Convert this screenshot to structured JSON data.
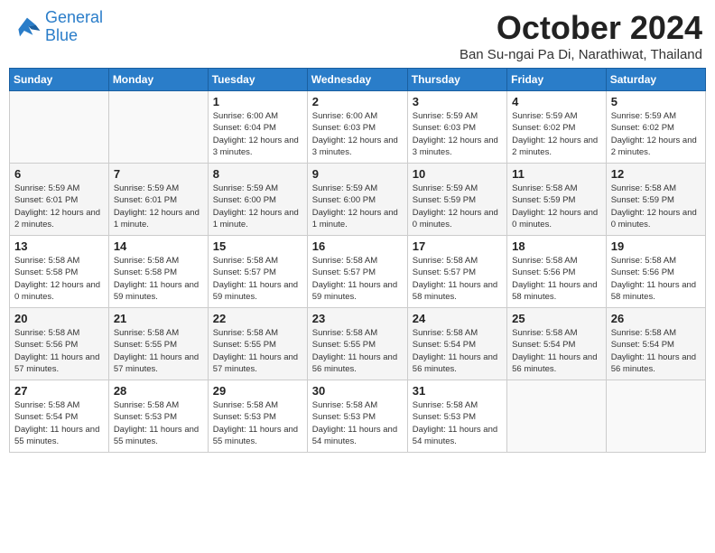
{
  "header": {
    "logo_line1": "General",
    "logo_line2": "Blue",
    "month": "October 2024",
    "location": "Ban Su-ngai Pa Di, Narathiwat, Thailand"
  },
  "weekdays": [
    "Sunday",
    "Monday",
    "Tuesday",
    "Wednesday",
    "Thursday",
    "Friday",
    "Saturday"
  ],
  "weeks": [
    [
      {
        "day": "",
        "info": ""
      },
      {
        "day": "",
        "info": ""
      },
      {
        "day": "1",
        "info": "Sunrise: 6:00 AM\nSunset: 6:04 PM\nDaylight: 12 hours and 3 minutes."
      },
      {
        "day": "2",
        "info": "Sunrise: 6:00 AM\nSunset: 6:03 PM\nDaylight: 12 hours and 3 minutes."
      },
      {
        "day": "3",
        "info": "Sunrise: 5:59 AM\nSunset: 6:03 PM\nDaylight: 12 hours and 3 minutes."
      },
      {
        "day": "4",
        "info": "Sunrise: 5:59 AM\nSunset: 6:02 PM\nDaylight: 12 hours and 2 minutes."
      },
      {
        "day": "5",
        "info": "Sunrise: 5:59 AM\nSunset: 6:02 PM\nDaylight: 12 hours and 2 minutes."
      }
    ],
    [
      {
        "day": "6",
        "info": "Sunrise: 5:59 AM\nSunset: 6:01 PM\nDaylight: 12 hours and 2 minutes."
      },
      {
        "day": "7",
        "info": "Sunrise: 5:59 AM\nSunset: 6:01 PM\nDaylight: 12 hours and 1 minute."
      },
      {
        "day": "8",
        "info": "Sunrise: 5:59 AM\nSunset: 6:00 PM\nDaylight: 12 hours and 1 minute."
      },
      {
        "day": "9",
        "info": "Sunrise: 5:59 AM\nSunset: 6:00 PM\nDaylight: 12 hours and 1 minute."
      },
      {
        "day": "10",
        "info": "Sunrise: 5:59 AM\nSunset: 5:59 PM\nDaylight: 12 hours and 0 minutes."
      },
      {
        "day": "11",
        "info": "Sunrise: 5:58 AM\nSunset: 5:59 PM\nDaylight: 12 hours and 0 minutes."
      },
      {
        "day": "12",
        "info": "Sunrise: 5:58 AM\nSunset: 5:59 PM\nDaylight: 12 hours and 0 minutes."
      }
    ],
    [
      {
        "day": "13",
        "info": "Sunrise: 5:58 AM\nSunset: 5:58 PM\nDaylight: 12 hours and 0 minutes."
      },
      {
        "day": "14",
        "info": "Sunrise: 5:58 AM\nSunset: 5:58 PM\nDaylight: 11 hours and 59 minutes."
      },
      {
        "day": "15",
        "info": "Sunrise: 5:58 AM\nSunset: 5:57 PM\nDaylight: 11 hours and 59 minutes."
      },
      {
        "day": "16",
        "info": "Sunrise: 5:58 AM\nSunset: 5:57 PM\nDaylight: 11 hours and 59 minutes."
      },
      {
        "day": "17",
        "info": "Sunrise: 5:58 AM\nSunset: 5:57 PM\nDaylight: 11 hours and 58 minutes."
      },
      {
        "day": "18",
        "info": "Sunrise: 5:58 AM\nSunset: 5:56 PM\nDaylight: 11 hours and 58 minutes."
      },
      {
        "day": "19",
        "info": "Sunrise: 5:58 AM\nSunset: 5:56 PM\nDaylight: 11 hours and 58 minutes."
      }
    ],
    [
      {
        "day": "20",
        "info": "Sunrise: 5:58 AM\nSunset: 5:56 PM\nDaylight: 11 hours and 57 minutes."
      },
      {
        "day": "21",
        "info": "Sunrise: 5:58 AM\nSunset: 5:55 PM\nDaylight: 11 hours and 57 minutes."
      },
      {
        "day": "22",
        "info": "Sunrise: 5:58 AM\nSunset: 5:55 PM\nDaylight: 11 hours and 57 minutes."
      },
      {
        "day": "23",
        "info": "Sunrise: 5:58 AM\nSunset: 5:55 PM\nDaylight: 11 hours and 56 minutes."
      },
      {
        "day": "24",
        "info": "Sunrise: 5:58 AM\nSunset: 5:54 PM\nDaylight: 11 hours and 56 minutes."
      },
      {
        "day": "25",
        "info": "Sunrise: 5:58 AM\nSunset: 5:54 PM\nDaylight: 11 hours and 56 minutes."
      },
      {
        "day": "26",
        "info": "Sunrise: 5:58 AM\nSunset: 5:54 PM\nDaylight: 11 hours and 56 minutes."
      }
    ],
    [
      {
        "day": "27",
        "info": "Sunrise: 5:58 AM\nSunset: 5:54 PM\nDaylight: 11 hours and 55 minutes."
      },
      {
        "day": "28",
        "info": "Sunrise: 5:58 AM\nSunset: 5:53 PM\nDaylight: 11 hours and 55 minutes."
      },
      {
        "day": "29",
        "info": "Sunrise: 5:58 AM\nSunset: 5:53 PM\nDaylight: 11 hours and 55 minutes."
      },
      {
        "day": "30",
        "info": "Sunrise: 5:58 AM\nSunset: 5:53 PM\nDaylight: 11 hours and 54 minutes."
      },
      {
        "day": "31",
        "info": "Sunrise: 5:58 AM\nSunset: 5:53 PM\nDaylight: 11 hours and 54 minutes."
      },
      {
        "day": "",
        "info": ""
      },
      {
        "day": "",
        "info": ""
      }
    ]
  ]
}
